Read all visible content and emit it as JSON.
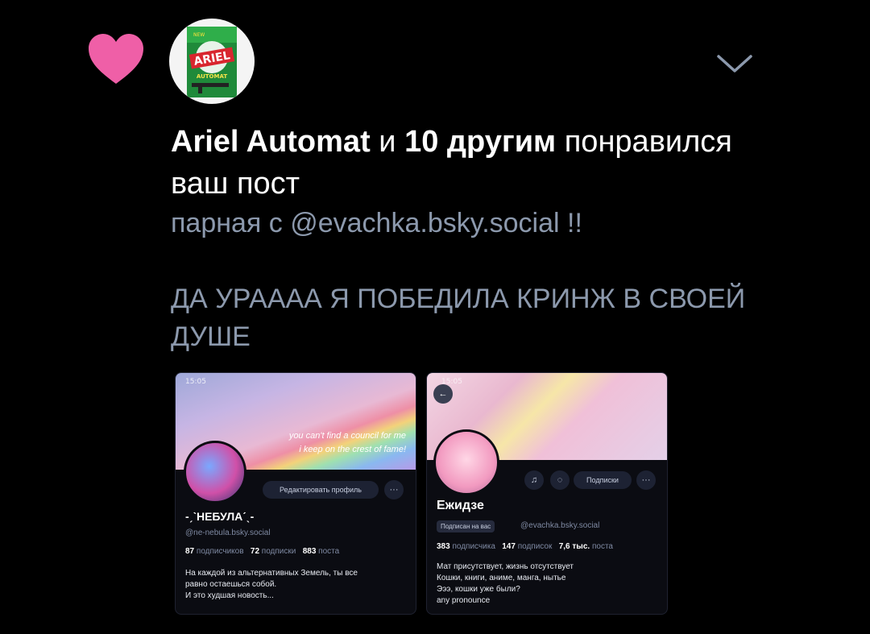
{
  "notification": {
    "actor": "Ariel Automat",
    "connector": " и ",
    "others": "10 другим",
    "action_line1": " понравился",
    "action_line2": "ваш пост"
  },
  "post": {
    "line1": "парная с @evachka.bsky.social !!",
    "line2": "ДА УРАААА Я ПОБЕДИЛА КРИНЖ В СВОЕЙ ДУШЕ"
  },
  "avatar": {
    "label_top": "ARIEL",
    "label_bottom": "AUTOMAT",
    "badge": "NEW"
  },
  "icons": {
    "heart": "heart-icon",
    "chevron": "chevron-down-icon"
  },
  "colors": {
    "heart": "#ef5fa7",
    "muted": "#8c99ad",
    "background": "#000000"
  },
  "screenshot1": {
    "time": "15:05",
    "lyric_line1": "you can't find a council for me",
    "lyric_line2": "i keep on the crest of fame!",
    "edit_button": "Редактировать профиль",
    "more": "···",
    "display_name": "-ˏˋНЕБУЛАˊˎ-",
    "handle": "@ne-nebula.bsky.social",
    "followers_count": "87",
    "followers_label": "подписчиков",
    "following_count": "72",
    "following_label": "подписки",
    "posts_count": "883",
    "posts_label": "поста",
    "bio_line1": "На каждой из альтернативных Земель, ты все",
    "bio_line2": "равно остаешься собой.",
    "bio_line3": "И это худшая новость..."
  },
  "screenshot2": {
    "time": "15:05",
    "subscribed_button": "Подписки",
    "more": "···",
    "display_name": "Ежидзе",
    "follows_you_badge": "Подписан на вас",
    "handle": "@evachka.bsky.social",
    "followers_count": "383",
    "followers_label": "подписчика",
    "following_count": "147",
    "following_label": "подписок",
    "posts_count": "7,6 тыс.",
    "posts_label": "поста",
    "bio_line1": "Мат присутствует, жизнь отсутствует",
    "bio_line2": "Кошки, книги, аниме, манга, нытье",
    "bio_line3": "Эээ, кошки уже были?",
    "bio_line4": "any pronounce"
  }
}
